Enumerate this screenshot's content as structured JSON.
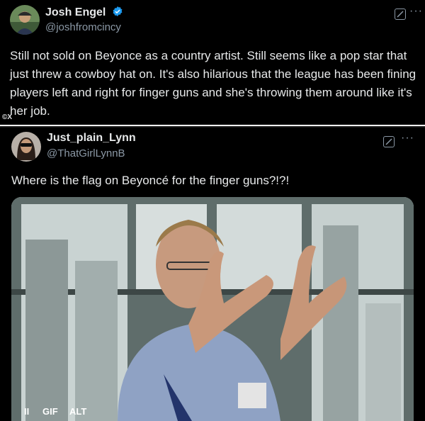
{
  "tweet1": {
    "name": "Josh Engel",
    "handle": "@joshfromcincy",
    "text": "Still not sold on Beyonce as a country artist. Still seems like a pop star that just threw a cowboy hat on. It's also hilarious that the league has been fining players left and right for finger guns and she's throwing them around like it's her job.",
    "credit": "©X"
  },
  "tweet2": {
    "name": "Just_plain_Lynn",
    "handle": "@ThatGirlLynnB",
    "text": "Where is the flag on Beyoncé for the finger guns?!?!",
    "media": {
      "pause_label": "II",
      "gif_label": "GIF",
      "alt_label": "ALT"
    }
  },
  "colors": {
    "verified": "#1d9bf0",
    "background": "#000000",
    "text": "#e7e9ea",
    "secondary": "#8b98a5"
  },
  "icons": [
    "verified-badge-icon",
    "grok-icon",
    "more-icon"
  ]
}
